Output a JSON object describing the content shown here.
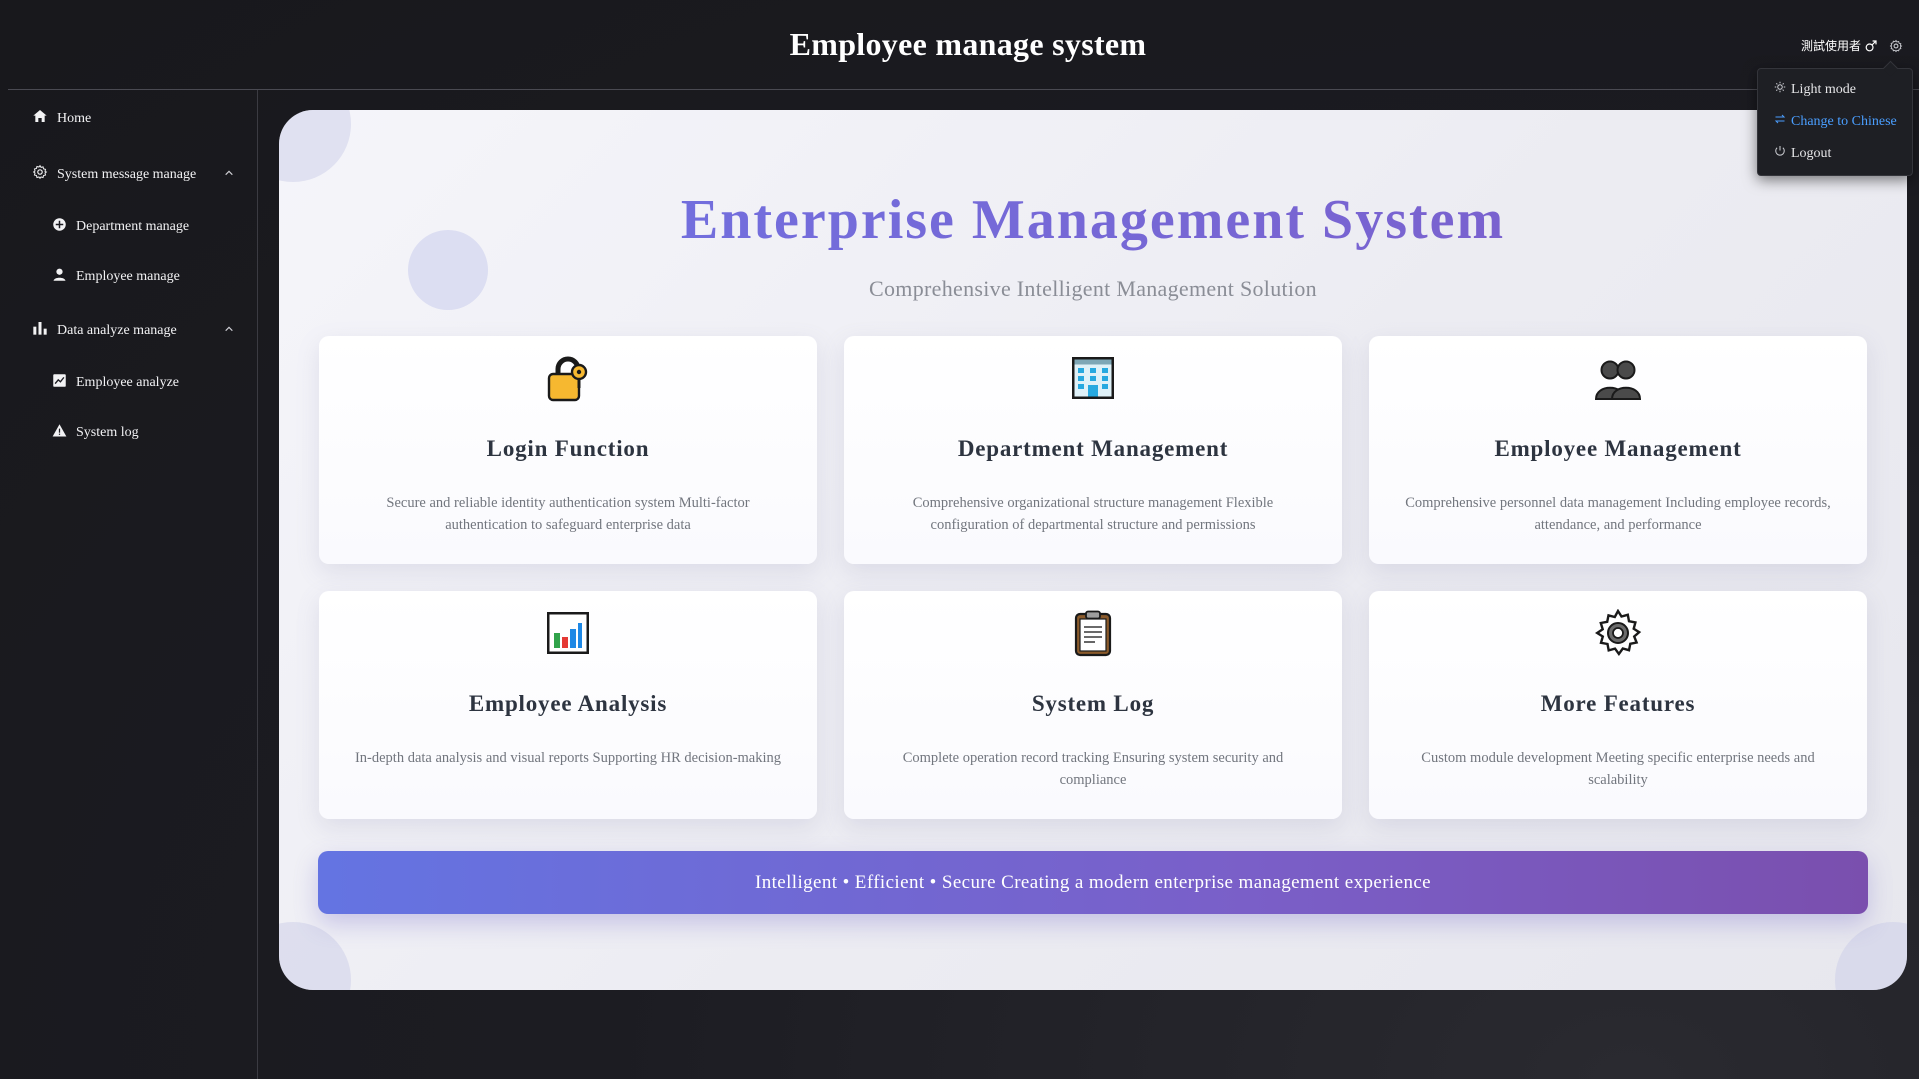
{
  "header": {
    "title": "Employee manage system",
    "user_name": "測試使用者"
  },
  "user_menu": {
    "items": [
      {
        "label": "Light mode",
        "icon": "sun-icon"
      },
      {
        "label": "Change to Chinese",
        "icon": "translate-icon",
        "active": true
      },
      {
        "label": "Logout",
        "icon": "power-icon"
      }
    ]
  },
  "sidebar": {
    "items": [
      {
        "label": "Home",
        "icon": "home-icon"
      },
      {
        "label": "System message manage",
        "icon": "gear-icon",
        "expanded": true
      },
      {
        "label": "Department manage",
        "icon": "department-icon"
      },
      {
        "label": "Employee manage",
        "icon": "user-icon"
      },
      {
        "label": "Data analyze manage",
        "icon": "bar-chart-icon",
        "expanded": true
      },
      {
        "label": "Employee analyze",
        "icon": "line-chart-icon"
      },
      {
        "label": "System log",
        "icon": "warning-icon"
      }
    ]
  },
  "hero": {
    "title": "Enterprise Management System",
    "subtitle": "Comprehensive Intelligent Management Solution"
  },
  "features": [
    {
      "icon": "lock-key-icon",
      "title": "Login Function",
      "description": "Secure and reliable identity authentication system Multi-factor authentication to safeguard enterprise data"
    },
    {
      "icon": "office-building-icon",
      "title": "Department Management",
      "description": "Comprehensive organizational structure management Flexible configuration of departmental structure and permissions"
    },
    {
      "icon": "people-icon",
      "title": "Employee Management",
      "description": "Comprehensive personnel data management Including employee records, attendance, and performance"
    },
    {
      "icon": "bar-chart-emoji-icon",
      "title": "Employee Analysis",
      "description": "In-depth data analysis and visual reports Supporting HR decision-making"
    },
    {
      "icon": "clipboard-icon",
      "title": "System Log",
      "description": "Complete operation record tracking Ensuring system security and compliance"
    },
    {
      "icon": "gear-emoji-icon",
      "title": "More Features",
      "description": "Custom module development Meeting specific enterprise needs and scalability"
    }
  ],
  "banner": {
    "text": "Intelligent • Efficient • Secure Creating a modern enterprise management experience"
  },
  "colors": {
    "accent_link": "#4a9eff",
    "hero_gradient_start": "#6f74e4",
    "hero_gradient_end": "#7d5cc8",
    "banner_gradient_start": "#6474e2",
    "banner_gradient_end": "#7a4fae"
  }
}
